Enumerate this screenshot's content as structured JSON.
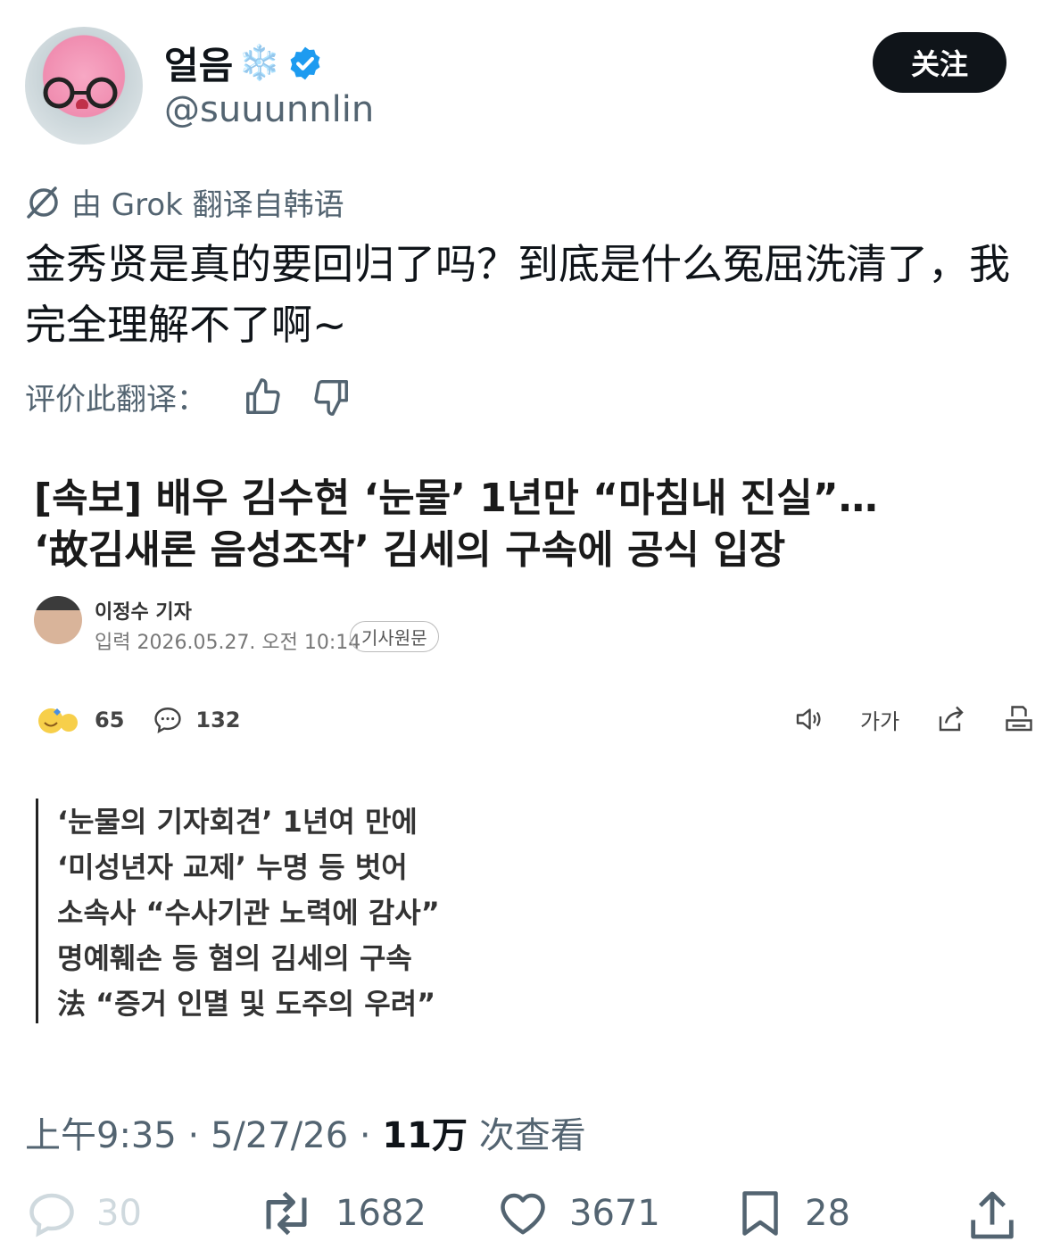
{
  "header": {
    "display_name": "얼음",
    "name_emoji": "❄️",
    "handle": "@suuunnlin",
    "follow_label": "关注"
  },
  "translation": {
    "note": "由 Grok 翻译自韩语",
    "text": "金秀贤是真的要回归了吗？到底是什么冤屈洗清了，我完全理解不了啊~",
    "rate_label": "评价此翻译："
  },
  "article": {
    "title_line1": "[속보] 배우 김수현 ‘눈물’ 1년만 “마침내 진실”…",
    "title_line2": "‘故김새론 음성조작’ 김세의 구속에 공식 입장",
    "reporter": "이정수 기자",
    "date": "입력 2026.05.27. 오전 10:14",
    "original_label": "기사원문",
    "reactions": "65",
    "comments": "132",
    "font_size_label": "가가",
    "summary": [
      "‘눈물의 기자회견’ 1년여 만에",
      "‘미성년자 교제’ 누명 등 벗어",
      "소속사 “수사기관 노력에 감사”",
      "명예훼손 등 혐의 김세의 구속",
      "法 “증거 인멸 및 도주의 우려”"
    ]
  },
  "meta": {
    "time": "上午9:35",
    "date": "5/27/26",
    "views": "11万",
    "views_label": "次查看"
  },
  "actions": {
    "replies": "30",
    "retweets": "1682",
    "likes": "3671",
    "bookmarks": "28"
  },
  "colors": {
    "text": "#0f1419",
    "secondary": "#536471",
    "verified": "#1d9bf0"
  }
}
